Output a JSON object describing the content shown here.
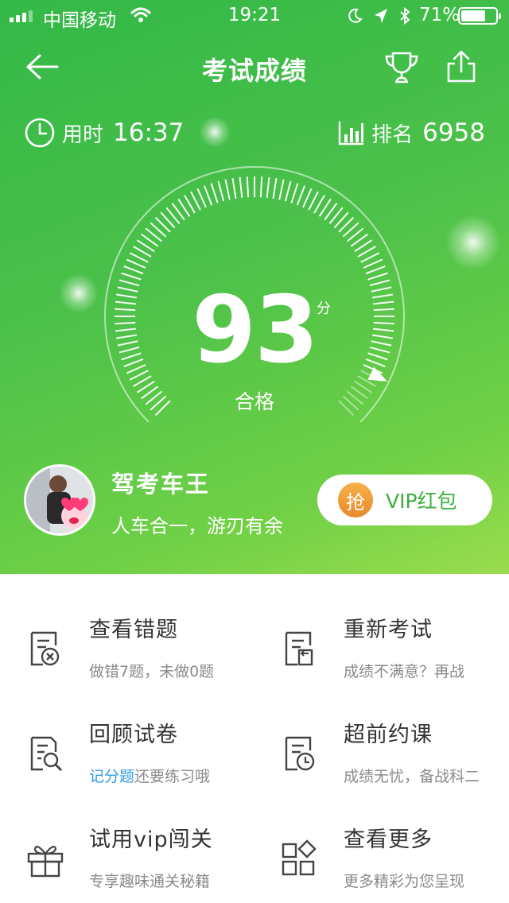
{
  "status_bar": {
    "carrier": "中国移动",
    "time": "19:21",
    "battery_pct": "71%",
    "battery_level": 0.71
  },
  "header": {
    "title": "考试成绩",
    "back_icon": "arrow-left-icon",
    "trophy_icon": "trophy-icon",
    "share_icon": "share-icon"
  },
  "stats": {
    "time_label": "用时",
    "time_value": "16:37",
    "rank_label": "排名",
    "rank_value": "6958"
  },
  "score": {
    "value": "93",
    "unit": "分",
    "result": "合格",
    "max": 100,
    "score_numeric": 93
  },
  "user": {
    "name": "驾考车王",
    "motto": "人车合一，游刃有余"
  },
  "vip_button": {
    "badge": "抢",
    "label": "VIP红包"
  },
  "menu": {
    "items": [
      {
        "title": "查看错题",
        "subtitle": "做错7题，未做0题",
        "icon": "wrong-answers-icon"
      },
      {
        "title": "重新考试",
        "subtitle": "成绩不满意？再战",
        "icon": "retake-exam-icon"
      },
      {
        "title": "回顾试卷",
        "subtitle_highlight": "记分题",
        "subtitle_rest": "还要练习哦",
        "icon": "review-paper-icon"
      },
      {
        "title": "超前约课",
        "subtitle": "成绩无忧，备战科二",
        "icon": "schedule-class-icon"
      },
      {
        "title": "试用vip闯关",
        "subtitle": "专享趣味通关秘籍",
        "icon": "gift-icon"
      },
      {
        "title": "查看更多",
        "subtitle": "更多精彩为您呈现",
        "icon": "more-apps-icon"
      }
    ]
  },
  "colors": {
    "hero_green": "#4cc14a",
    "accent_blue": "#2f9ce6",
    "vip_text": "#3caf3b",
    "badge_orange": "#e98a2c"
  }
}
